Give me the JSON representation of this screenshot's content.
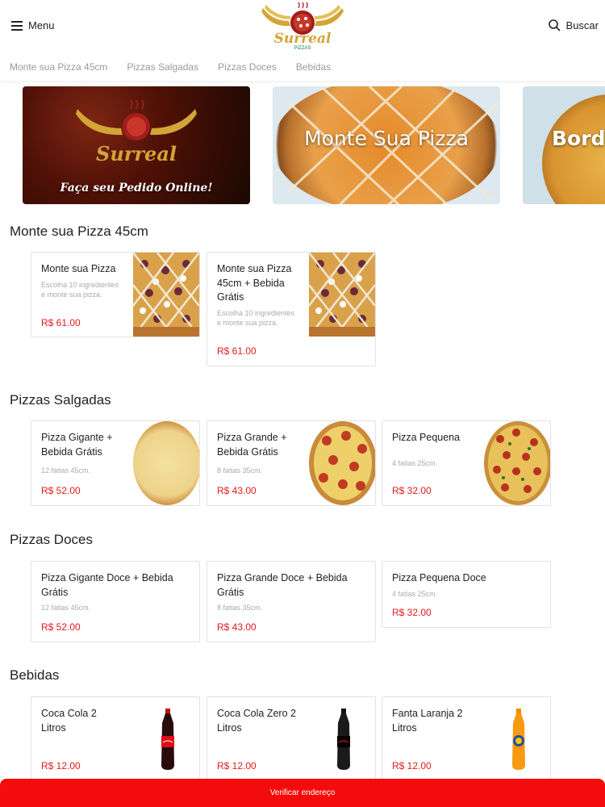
{
  "header": {
    "menu_label": "Menu",
    "search_label": "Buscar",
    "logo_text": "Surreal",
    "logo_subtext": "PIZZAS"
  },
  "tabs": [
    "Monte sua Pizza 45cm",
    "Pizzas Salgadas",
    "Pizzas Doces",
    "Bebidas"
  ],
  "banners": [
    {
      "title": "Surreal",
      "subtitle": "Faça seu Pedido Online!"
    },
    {
      "title": "Monte Sua Pizza"
    },
    {
      "title": "Bord"
    }
  ],
  "sections": [
    {
      "title": "Monte sua Pizza 45cm",
      "items": [
        {
          "name": "Monte sua Pizza",
          "desc": "Escolha 10 ingredientes e monte sua pizza.",
          "price": "R$ 61.00"
        },
        {
          "name": "Monte sua Pizza 45cm + Bebida Grátis",
          "desc": "Escolha 10 ingredientes e monte sua pizza.",
          "price": "R$ 61.00"
        }
      ]
    },
    {
      "title": "Pizzas Salgadas",
      "items": [
        {
          "name": "Pizza Gigante + Bebida Grátis",
          "desc": "12 fatias 45cm.",
          "price": "R$ 52.00"
        },
        {
          "name": "Pizza Grande + Bebida Grátis",
          "desc": "8 fatias 35cm.",
          "price": "R$ 43.00"
        },
        {
          "name": "Pizza Pequena",
          "desc": "4 fatias 25cm.",
          "price": "R$ 32.00"
        }
      ]
    },
    {
      "title": "Pizzas Doces",
      "items": [
        {
          "name": "Pizza Gigante Doce + Bebida Grátis",
          "desc": "12 fatias 45cm.",
          "price": "R$ 52.00"
        },
        {
          "name": "Pizza Grande Doce + Bebida Grátis",
          "desc": "8 fatias 35cm.",
          "price": "R$ 43.00"
        },
        {
          "name": "Pizza Pequena Doce",
          "desc": "4 fatias 25cm.",
          "price": "R$ 32.00"
        }
      ]
    },
    {
      "title": "Bebidas",
      "items": [
        {
          "name": "Coca Cola 2 Litros",
          "price": "R$ 12.00"
        },
        {
          "name": "Coca Cola Zero 2 Litros",
          "price": "R$ 12.00"
        },
        {
          "name": "Fanta Laranja 2 Litros",
          "price": "R$ 12.00"
        }
      ]
    }
  ],
  "footer": {
    "button_label": "Verificar endereço"
  },
  "colors": {
    "price": "#e31a1a",
    "bottom_bar": "#f40c0c",
    "logo_gold": "#d4a437"
  }
}
